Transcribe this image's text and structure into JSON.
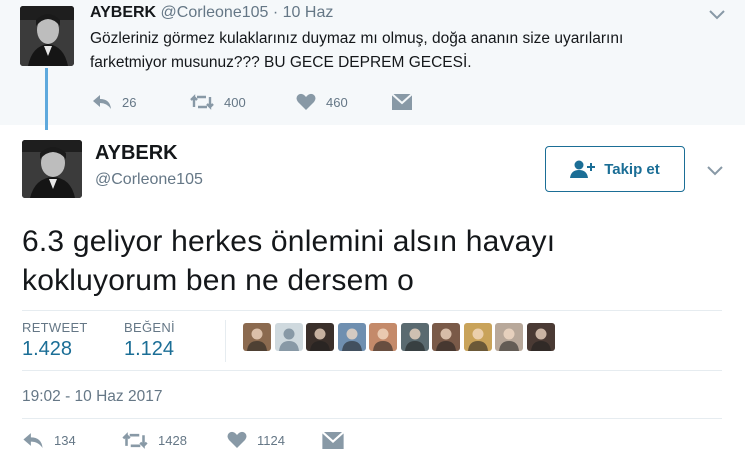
{
  "parent_tweet": {
    "name": "AYBERK",
    "handle": "@Corleone105",
    "separator": "·",
    "time": "10 Haz",
    "text_line1": "Gözleriniz görmez kulaklarınız duymaz mı olmuş, doğa ananın size uyarılarını",
    "text_line2": "farketmiyor musunuz??? BU GECE DEPREM GECESİ.",
    "actions": {
      "reply_count": "26",
      "retweet_count": "400",
      "like_count": "460"
    }
  },
  "main_tweet": {
    "name": "AYBERK",
    "handle": "@Corleone105",
    "follow_label": "Takip et",
    "text_line1": "6.3 geliyor herkes önlemini alsın havayı",
    "text_line2": "kokluyorum ben ne dersem o",
    "stats": {
      "retweet_label": "RETWEET",
      "retweet_value": "1.428",
      "like_label": "BEĞENİ",
      "like_value": "1.124"
    },
    "liker_avatars": [
      {
        "icon": "avatar-photo",
        "color": "#8b6a4f"
      },
      {
        "icon": "default-user-icon",
        "color": "#cfd9de"
      },
      {
        "icon": "avatar-photo",
        "color": "#3a2f2a"
      },
      {
        "icon": "avatar-photo",
        "color": "#6f8fb0"
      },
      {
        "icon": "avatar-photo",
        "color": "#c48a6a"
      },
      {
        "icon": "avatar-photo",
        "color": "#5a6a70"
      },
      {
        "icon": "avatar-photo",
        "color": "#7a5a48"
      },
      {
        "icon": "avatar-photo",
        "color": "#c9a35a"
      },
      {
        "icon": "avatar-photo",
        "color": "#b8a89a"
      },
      {
        "icon": "avatar-photo",
        "color": "#4a3a34"
      }
    ],
    "timestamp": "19:02 - 10 Haz 2017",
    "actions": {
      "reply_count": "134",
      "retweet_count": "1428",
      "like_count": "1124"
    }
  },
  "colors": {
    "accent": "#1b6e96",
    "muted": "#657786",
    "parent_bg": "#f5f8fa",
    "thread_line": "#5ea9dd"
  }
}
